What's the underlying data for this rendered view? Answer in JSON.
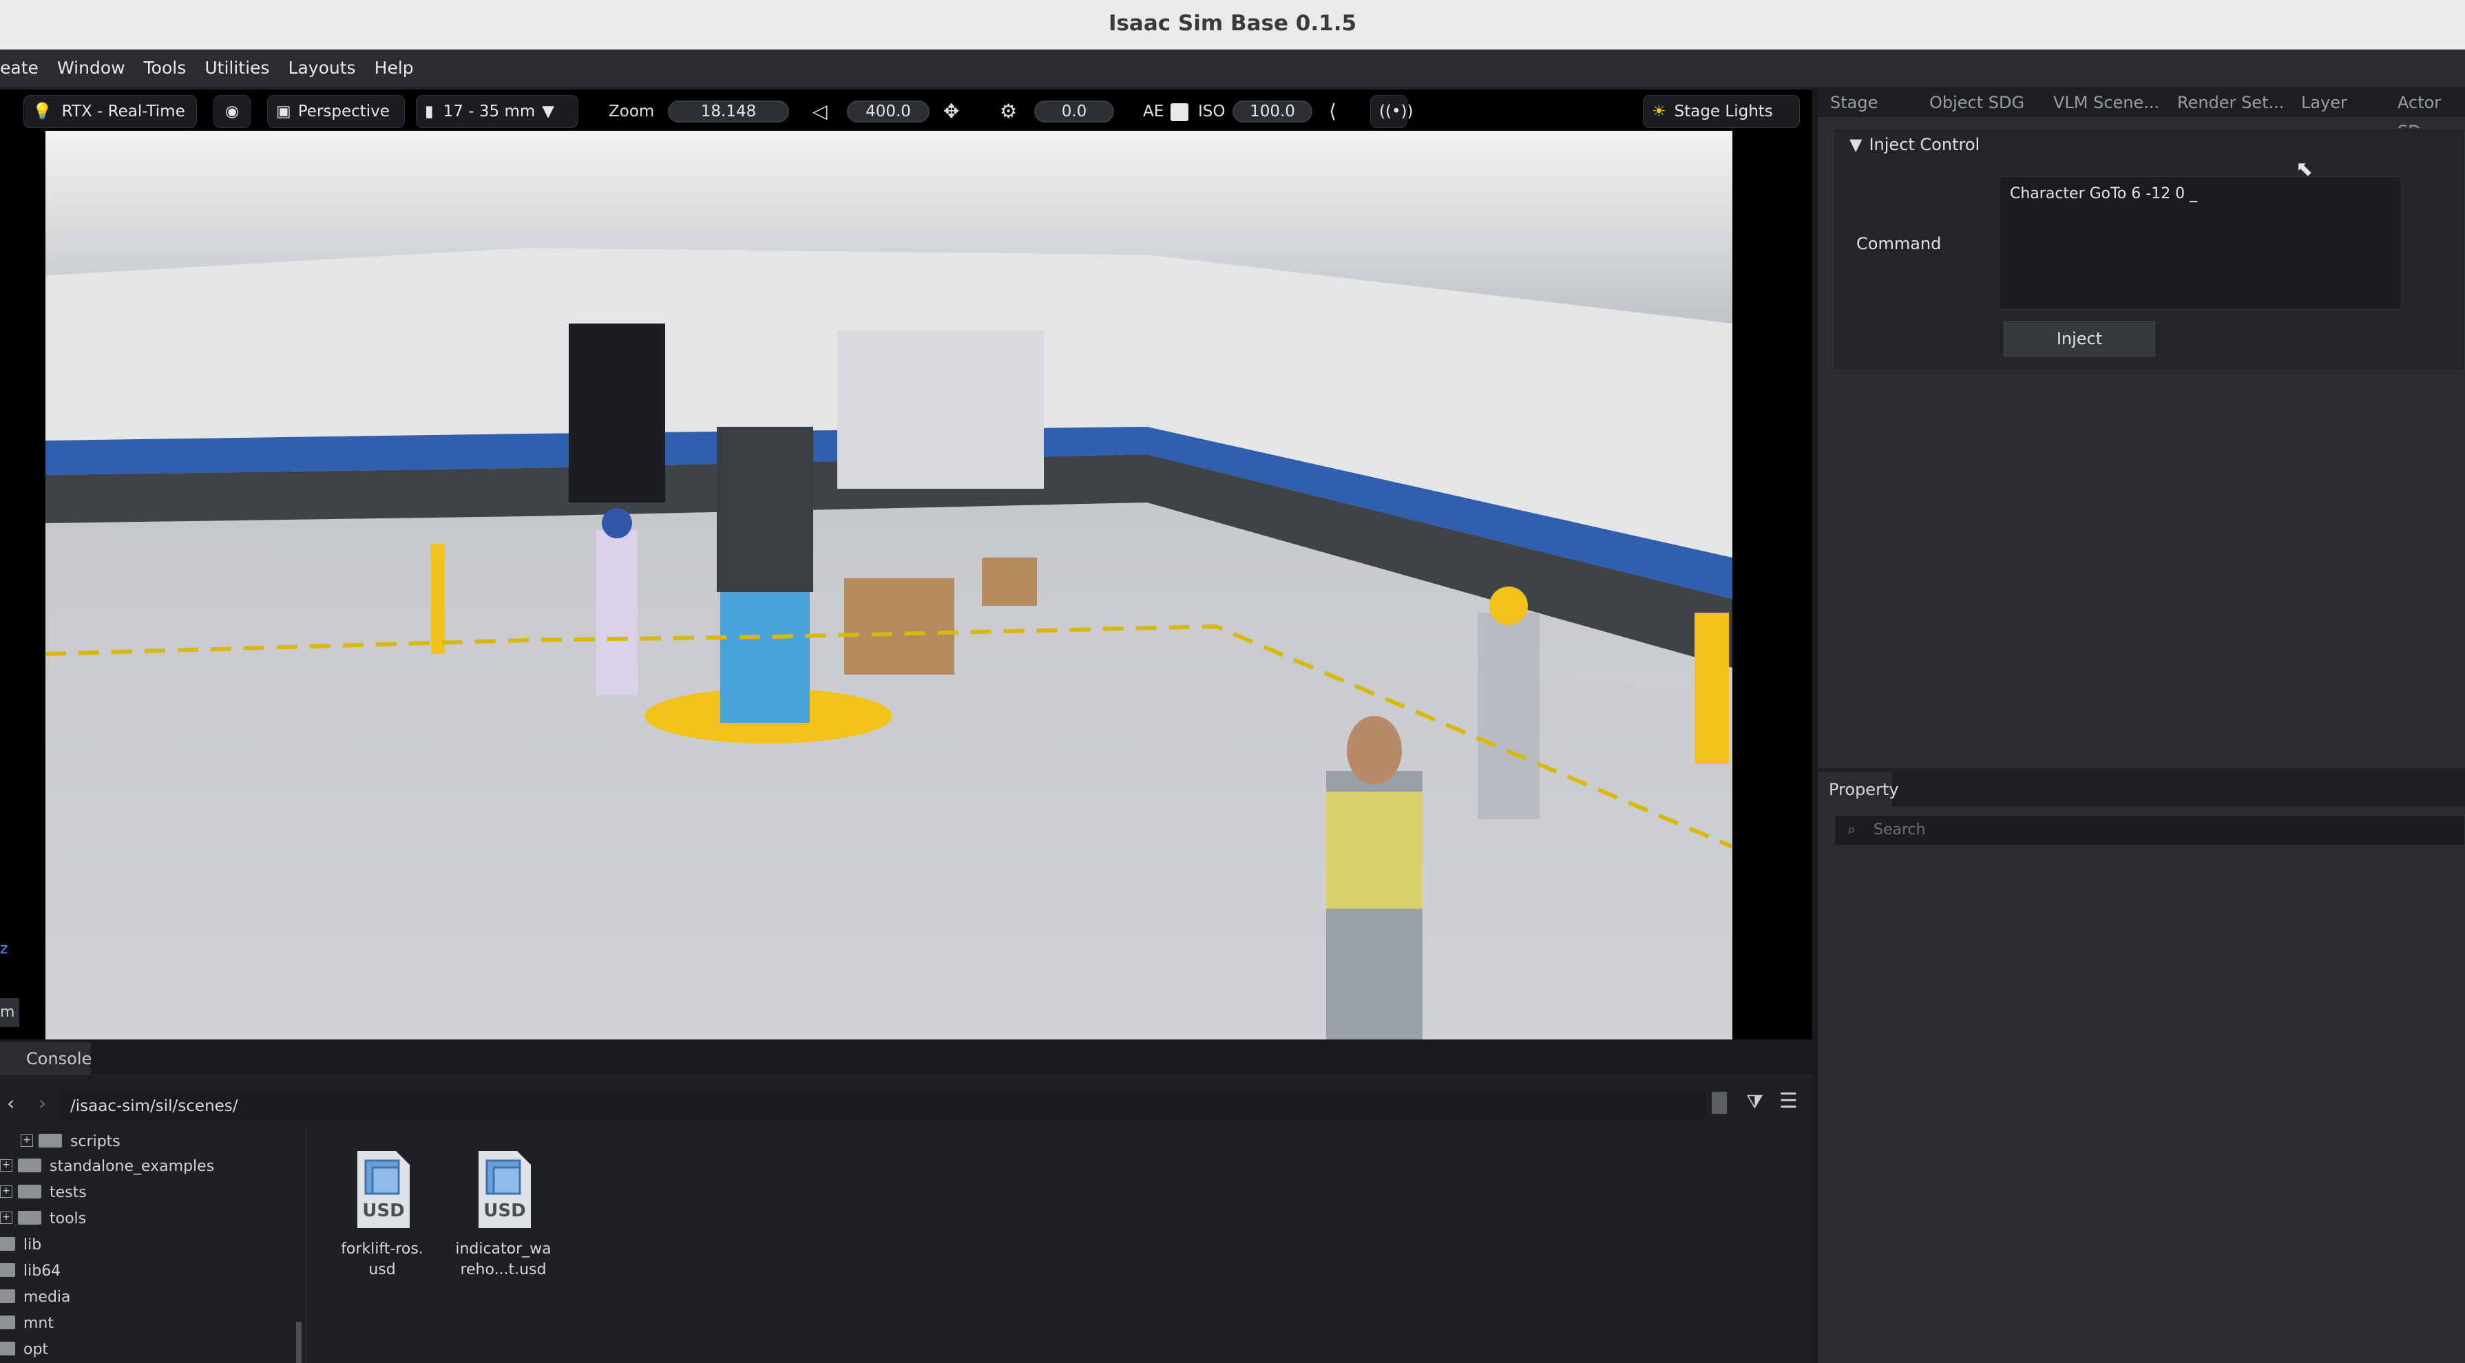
{
  "window": {
    "title": "Isaac Sim Base 0.1.5"
  },
  "menu": {
    "items": [
      "eate",
      "Window",
      "Tools",
      "Utilities",
      "Layouts",
      "Help"
    ]
  },
  "viewport_toolbar": {
    "renderer": "RTX - Real-Time",
    "camera": "Perspective",
    "lens": "17 - 35 mm",
    "zoom_label": "Zoom",
    "zoom_value": "18.148",
    "fov_value": "400.0",
    "exposure_value": "0.0",
    "ae_label": "AE",
    "iso_label": "ISO",
    "iso_value": "100.0",
    "stage_lights": "Stage Lights"
  },
  "viewport_side_label": "m",
  "right_tabs": [
    "Stage",
    "Object SDG",
    "VLM Scene...",
    "Render Set...",
    "Layer",
    "Actor SD"
  ],
  "inject_control": {
    "header": "Inject Control",
    "command_label": "Command",
    "command_value": "Character GoTo 6 -12 0 _",
    "inject_button": "Inject"
  },
  "property": {
    "tab": "Property",
    "search_placeholder": "Search"
  },
  "bottom": {
    "console_tab": "Console",
    "path": "/isaac-sim/sil/scenes/",
    "tree": [
      {
        "label": "scripts",
        "expandable": true
      },
      {
        "label": "standalone_examples",
        "expandable": true
      },
      {
        "label": "tests",
        "expandable": true
      },
      {
        "label": "tools",
        "expandable": true
      },
      {
        "label": "lib",
        "expandable": false
      },
      {
        "label": "lib64",
        "expandable": false
      },
      {
        "label": "media",
        "expandable": false
      },
      {
        "label": "mnt",
        "expandable": false
      },
      {
        "label": "opt",
        "expandable": false
      }
    ],
    "files": [
      {
        "name": "forklift-ros.\nusd",
        "icon_text": "USD"
      },
      {
        "name": "indicator_wa\nreho...t.usd",
        "icon_text": "USD"
      }
    ]
  }
}
